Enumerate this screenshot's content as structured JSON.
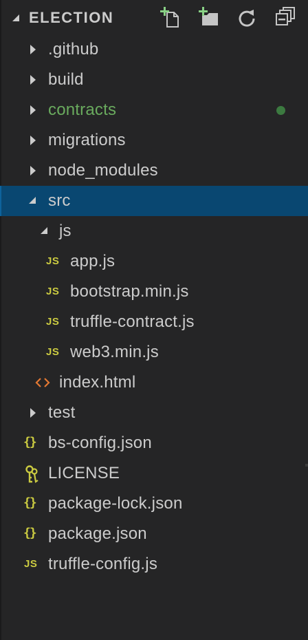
{
  "header": {
    "title": "ELECTION",
    "actions": [
      {
        "icon": "new-file-icon"
      },
      {
        "icon": "new-folder-icon"
      },
      {
        "icon": "refresh-icon"
      },
      {
        "icon": "collapse-all-icon"
      }
    ]
  },
  "colors": {
    "background": "#252526",
    "selection": "#094771",
    "text": "#cccccc",
    "git_modified": "#6aab5e",
    "js_icon": "#cbcb41",
    "html_icon": "#e37933"
  },
  "tree": [
    {
      "label": ".github",
      "type": "folder",
      "expanded": false
    },
    {
      "label": "build",
      "type": "folder",
      "expanded": false
    },
    {
      "label": "contracts",
      "type": "folder",
      "expanded": false,
      "git_status": "modified"
    },
    {
      "label": "migrations",
      "type": "folder",
      "expanded": false
    },
    {
      "label": "node_modules",
      "type": "folder",
      "expanded": false
    },
    {
      "label": "src",
      "type": "folder",
      "expanded": true,
      "selected": true
    },
    {
      "label": "js",
      "type": "folder",
      "expanded": true
    },
    {
      "label": "app.js",
      "type": "file",
      "icon": "JS"
    },
    {
      "label": "bootstrap.min.js",
      "type": "file",
      "icon": "JS"
    },
    {
      "label": "truffle-contract.js",
      "type": "file",
      "icon": "JS"
    },
    {
      "label": "web3.min.js",
      "type": "file",
      "icon": "JS"
    },
    {
      "label": "index.html",
      "type": "file",
      "icon": "html-icon"
    },
    {
      "label": "test",
      "type": "folder",
      "expanded": false
    },
    {
      "label": "bs-config.json",
      "type": "file",
      "icon": "{}"
    },
    {
      "label": "LICENSE",
      "type": "file",
      "icon": "license-key-icon"
    },
    {
      "label": "package-lock.json",
      "type": "file",
      "icon": "{}"
    },
    {
      "label": "package.json",
      "type": "file",
      "icon": "{}"
    },
    {
      "label": "truffle-config.js",
      "type": "file",
      "icon": "JS"
    }
  ]
}
